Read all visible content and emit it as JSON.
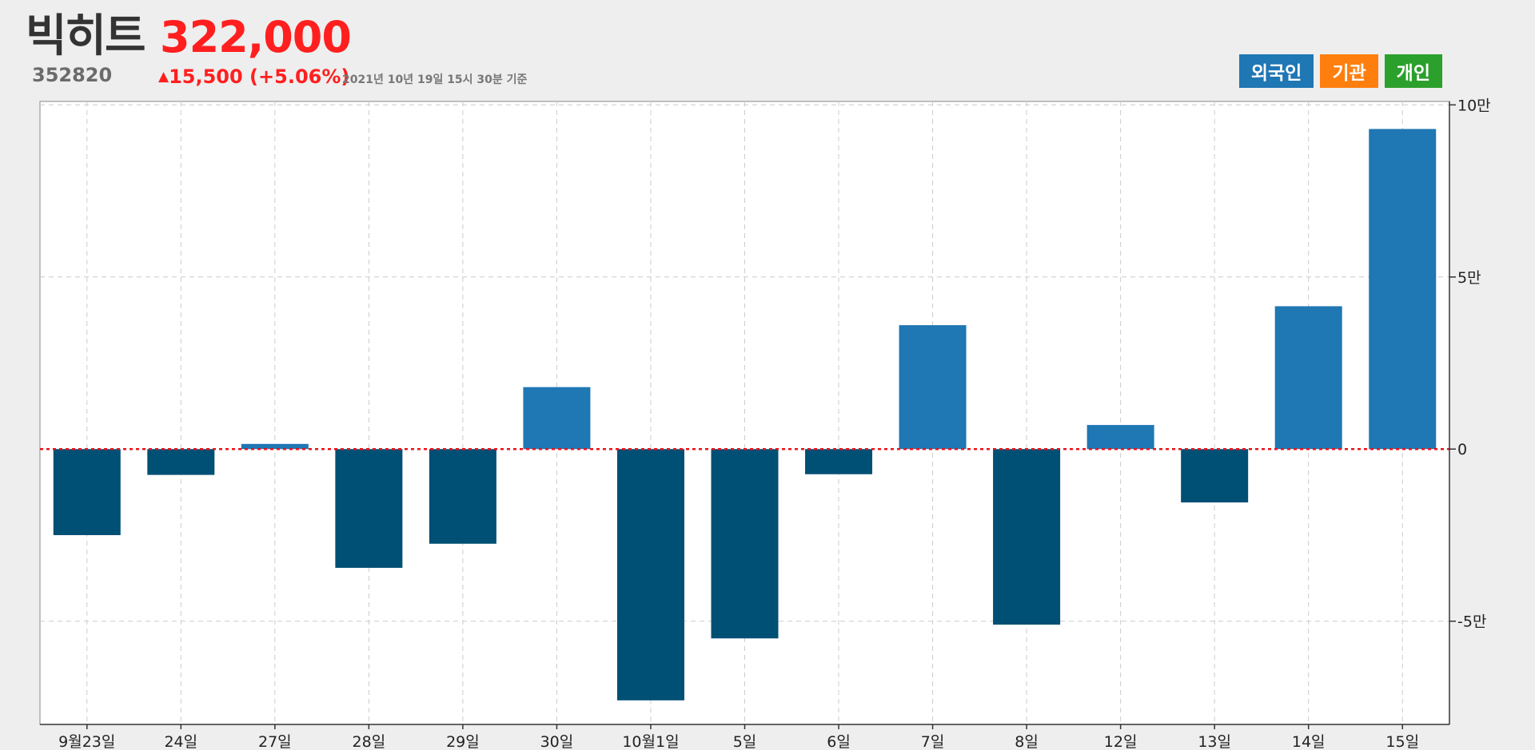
{
  "stock": {
    "name": "빅히트",
    "code": "352820",
    "price": "322,000",
    "change_arrow": "▲",
    "change_text": "15,500 (+5.06%)",
    "as_of": "2021년 10년 19일 15시 30분 기준"
  },
  "legend": {
    "items": [
      {
        "label": "외국인",
        "color": "#1f77b4",
        "active": true
      },
      {
        "label": "기관",
        "color": "#ff7f0e",
        "active": false
      },
      {
        "label": "개인",
        "color": "#2ca02c",
        "active": false
      }
    ]
  },
  "colors": {
    "up_price": "#ff1f1f",
    "positive_bar": "#1f77b4",
    "negative_bar": "#004f75",
    "zero_line": "#e8141b",
    "grid": "#cccccc",
    "plot_bg": "#ffffff",
    "page_bg": "#eeeeee"
  },
  "chart_data": {
    "type": "bar",
    "title": "",
    "xlabel": "",
    "ylabel": "",
    "series": [
      {
        "name": "외국인",
        "values": [
          -25000,
          -7500,
          1500,
          -34500,
          -27500,
          18000,
          -73000,
          -55000,
          -7300,
          36000,
          -51000,
          7000,
          -15500,
          41500,
          93000
        ]
      }
    ],
    "categories": [
      "9월23일",
      "24일",
      "27일",
      "28일",
      "29일",
      "30일",
      "10월1일",
      "5일",
      "6일",
      "7일",
      "8일",
      "12일",
      "13일",
      "14일",
      "15일"
    ],
    "ylim": [
      -80000,
      101000
    ],
    "yticks": [
      100000,
      50000,
      0,
      -50000
    ],
    "ytick_labels": [
      "10만",
      "5만",
      "0",
      "-5만"
    ],
    "y_axis_position": "right",
    "grid": true,
    "zero_line": "dotted-red",
    "legend_position": "top-right"
  }
}
